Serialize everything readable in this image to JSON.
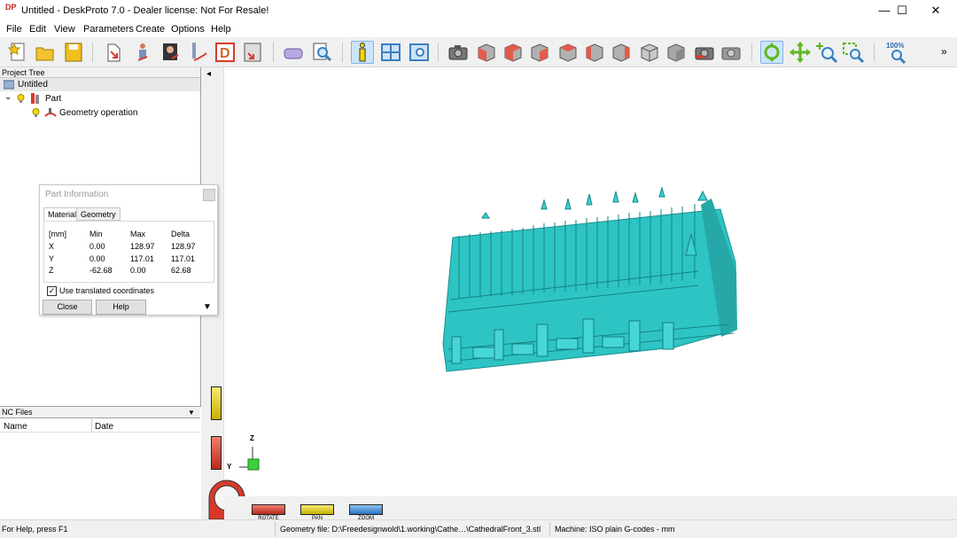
{
  "window": {
    "title": "Untitled - DeskProto 7.0 - Dealer license: Not For Resale!",
    "app_icon_text": "DP",
    "minimize_glyph": "—",
    "maximize_glyph": "☐",
    "close_glyph": "✕"
  },
  "menu": [
    "File",
    "Edit",
    "View",
    "Parameters",
    "Create",
    "Options",
    "Help"
  ],
  "toolbar": {
    "zoom100_label": "100%",
    "overflow_glyph": "»",
    "accent_colors": {
      "cube_red": "#e25b4a",
      "cube_gray": "#b0b0b0",
      "nav_green": "#7ed321"
    }
  },
  "project_tree": {
    "header": "Project Tree",
    "root": "Untitled",
    "part": "Part",
    "operation": "Geometry operation",
    "expand_glyph": "⌄"
  },
  "part_info": {
    "title": "Part Information",
    "tabs": [
      "Material",
      "Geometry"
    ],
    "columns": [
      "[mm]",
      "Min",
      "Max",
      "Delta"
    ],
    "rows": [
      [
        "X",
        "0.00",
        "128.97",
        "128.97"
      ],
      [
        "Y",
        "0.00",
        "117.01",
        "117.01"
      ],
      [
        "Z",
        "-62.68",
        "0.00",
        "62.68"
      ]
    ],
    "checkbox_label": "Use translated coordinates",
    "checkbox_checked": true,
    "close_button": "Close",
    "help_button": "Help",
    "arrow_glyph": "▼"
  },
  "nc_files": {
    "header": "NC Files",
    "dropdown_glyph": "▼",
    "columns": [
      "Name",
      "Date"
    ]
  },
  "viewport": {
    "collapse_glyph": "◂",
    "axis_z": "Z",
    "axis_y": "Y",
    "model_color": "#2ec4c4",
    "bars": [
      {
        "label": "ROTATE",
        "color": "#d9392b"
      },
      {
        "label": "PAN",
        "color": "#e8d21c"
      },
      {
        "label": "ZOOM",
        "color": "#3a8fd9"
      }
    ]
  },
  "status": {
    "help": "For Help, press F1",
    "geometry": "Geometry file: D:\\Freedesignwold\\1.working\\Cathe…\\CathedralFront_3.stl",
    "machine": "Machine: ISO plain G-codes - mm"
  }
}
